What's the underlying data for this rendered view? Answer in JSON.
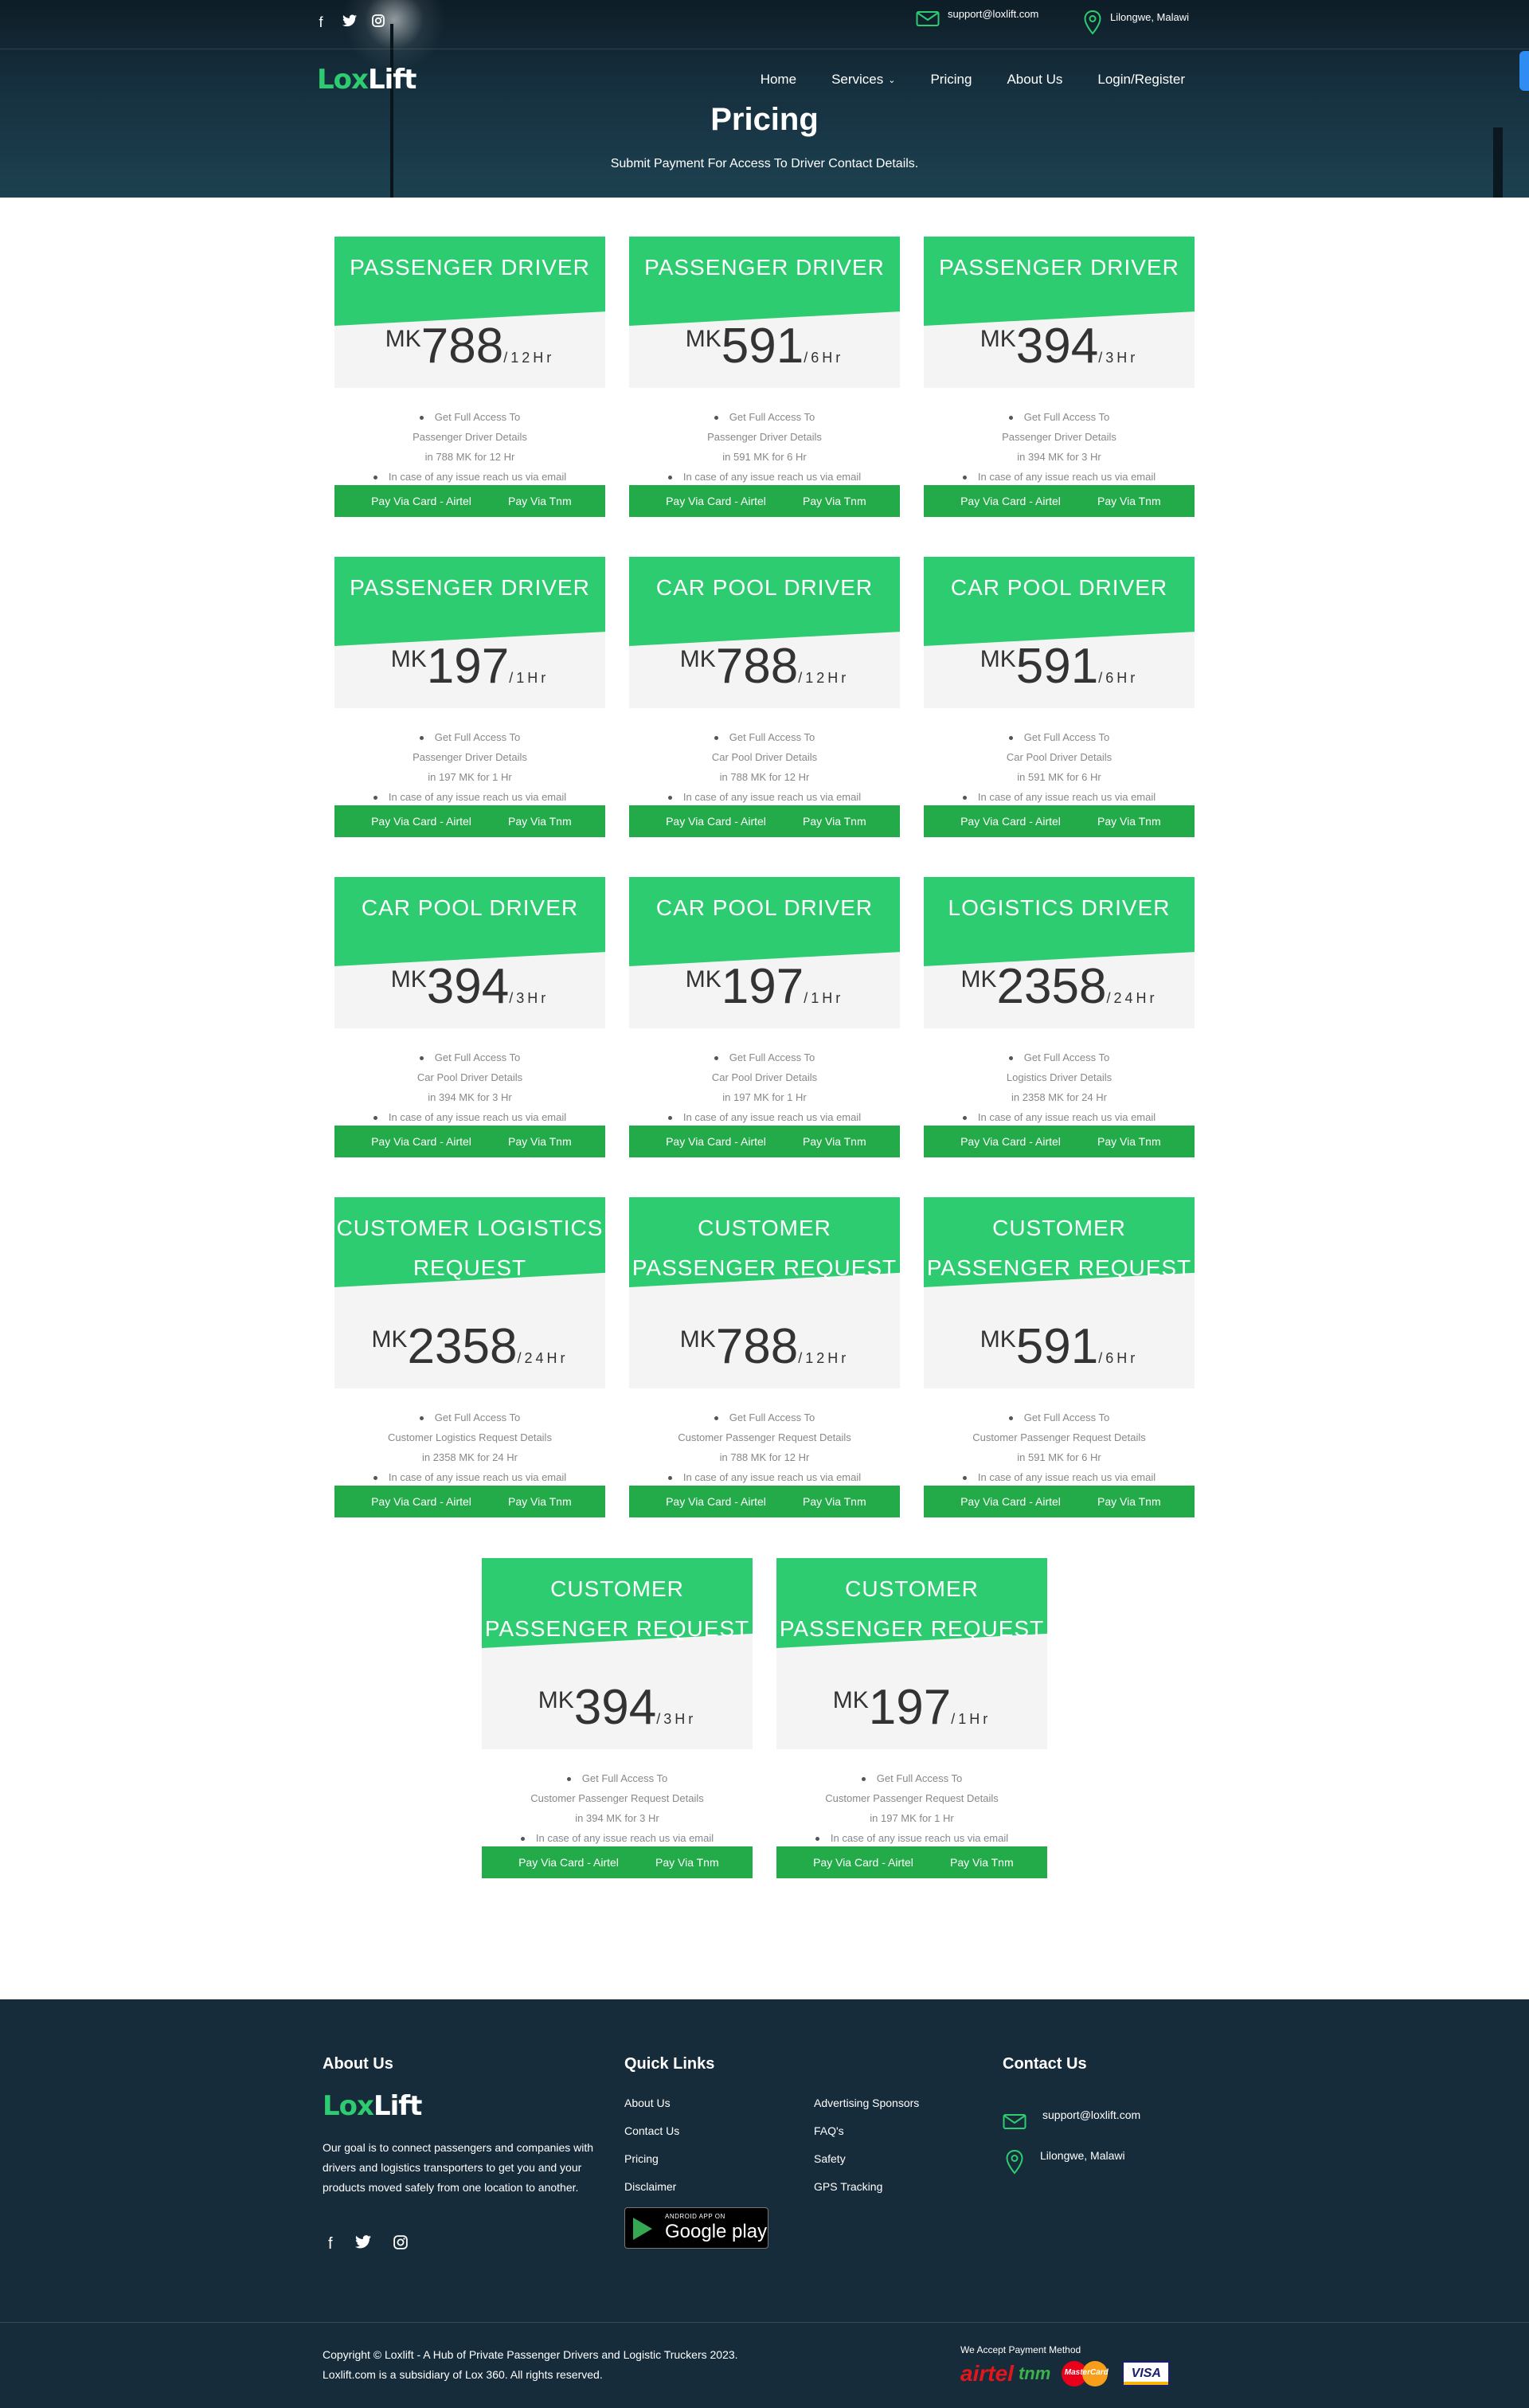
{
  "header": {
    "email": "support@loxlift.com",
    "location": "Lilongwe, Malawi",
    "logo_lox": "Lox",
    "logo_lift": "Lift",
    "nav": [
      {
        "label": "Home"
      },
      {
        "label": "Services",
        "has_dropdown": true
      },
      {
        "label": "Pricing"
      },
      {
        "label": "About Us"
      },
      {
        "label": "Login/Register"
      }
    ],
    "page_title": "Pricing",
    "page_subtitle": "Submit Payment For Access To Driver Contact Details."
  },
  "cards": [
    {
      "title": "PASSENGER DRIVER",
      "currency": "MK",
      "amount": "788",
      "period": "/12Hr",
      "f1": "Get Full Access To",
      "f2": "Passenger Driver Details",
      "f3": "in 788 MK for 12 Hr",
      "f4": "In case of any issue reach us via email",
      "btn1": "Pay Via Card - Airtel",
      "btn2": "Pay Via Tnm"
    },
    {
      "title": "PASSENGER DRIVER",
      "currency": "MK",
      "amount": "591",
      "period": "/6Hr",
      "f1": "Get Full Access To",
      "f2": "Passenger Driver Details",
      "f3": "in 591 MK for 6 Hr",
      "f4": "In case of any issue reach us via email",
      "btn1": "Pay Via Card - Airtel",
      "btn2": "Pay Via Tnm"
    },
    {
      "title": "PASSENGER DRIVER",
      "currency": "MK",
      "amount": "394",
      "period": "/3Hr",
      "f1": "Get Full Access To",
      "f2": "Passenger Driver Details",
      "f3": "in 394 MK for 3 Hr",
      "f4": "In case of any issue reach us via email",
      "btn1": "Pay Via Card - Airtel",
      "btn2": "Pay Via Tnm"
    },
    {
      "title": "PASSENGER DRIVER",
      "currency": "MK",
      "amount": "197",
      "period": "/1Hr",
      "f1": "Get Full Access To",
      "f2": "Passenger Driver Details",
      "f3": "in 197 MK for 1 Hr",
      "f4": "In case of any issue reach us via email",
      "btn1": "Pay Via Card - Airtel",
      "btn2": "Pay Via Tnm"
    },
    {
      "title": "CAR POOL DRIVER",
      "currency": "MK",
      "amount": "788",
      "period": "/12Hr",
      "f1": "Get Full Access To",
      "f2": "Car Pool Driver Details",
      "f3": "in 788 MK for 12 Hr",
      "f4": "In case of any issue reach us via email",
      "btn1": "Pay Via Card - Airtel",
      "btn2": "Pay Via Tnm"
    },
    {
      "title": "CAR POOL DRIVER",
      "currency": "MK",
      "amount": "591",
      "period": "/6Hr",
      "f1": "Get Full Access To",
      "f2": "Car Pool Driver Details",
      "f3": "in 591 MK for 6 Hr",
      "f4": "In case of any issue reach us via email",
      "btn1": "Pay Via Card - Airtel",
      "btn2": "Pay Via Tnm"
    },
    {
      "title": "CAR POOL DRIVER",
      "currency": "MK",
      "amount": "394",
      "period": "/3Hr",
      "f1": "Get Full Access To",
      "f2": "Car Pool Driver Details",
      "f3": "in 394 MK for 3 Hr",
      "f4": "In case of any issue reach us via email",
      "btn1": "Pay Via Card - Airtel",
      "btn2": "Pay Via Tnm"
    },
    {
      "title": "CAR POOL DRIVER",
      "currency": "MK",
      "amount": "197",
      "period": "/1Hr",
      "f1": "Get Full Access To",
      "f2": "Car Pool Driver Details",
      "f3": "in 197 MK for 1 Hr",
      "f4": "In case of any issue reach us via email",
      "btn1": "Pay Via Card - Airtel",
      "btn2": "Pay Via Tnm"
    },
    {
      "title": "LOGISTICS DRIVER",
      "currency": "MK",
      "amount": "2358",
      "period": "/24Hr",
      "f1": "Get Full Access To",
      "f2": "Logistics Driver Details",
      "f3": "in 2358 MK for 24 Hr",
      "f4": "In case of any issue reach us via email",
      "btn1": "Pay Via Card - Airtel",
      "btn2": "Pay Via Tnm"
    },
    {
      "title": "CUSTOMER LOGISTICS REQUEST",
      "currency": "MK",
      "amount": "2358",
      "period": "/24Hr",
      "f1": "Get Full Access To",
      "f2": "Customer Logistics Request Details",
      "f3": "in 2358 MK for 24 Hr",
      "f4": "In case of any issue reach us via email",
      "btn1": "Pay Via Card - Airtel",
      "btn2": "Pay Via Tnm"
    },
    {
      "title": "CUSTOMER PASSENGER REQUEST",
      "currency": "MK",
      "amount": "788",
      "period": "/12Hr",
      "f1": "Get Full Access To",
      "f2": "Customer Passenger Request Details",
      "f3": "in 788 MK for 12 Hr",
      "f4": "In case of any issue reach us via email",
      "btn1": "Pay Via Card - Airtel",
      "btn2": "Pay Via Tnm"
    },
    {
      "title": "CUSTOMER PASSENGER REQUEST",
      "currency": "MK",
      "amount": "591",
      "period": "/6Hr",
      "f1": "Get Full Access To",
      "f2": "Customer Passenger Request Details",
      "f3": "in 591 MK for 6 Hr",
      "f4": "In case of any issue reach us via email",
      "btn1": "Pay Via Card - Airtel",
      "btn2": "Pay Via Tnm"
    },
    {
      "title": "CUSTOMER PASSENGER REQUEST",
      "currency": "MK",
      "amount": "394",
      "period": "/3Hr",
      "f1": "Get Full Access To",
      "f2": "Customer Passenger Request Details",
      "f3": "in 394 MK for 3 Hr",
      "f4": "In case of any issue reach us via email",
      "btn1": "Pay Via Card - Airtel",
      "btn2": "Pay Via Tnm"
    },
    {
      "title": "CUSTOMER PASSENGER REQUEST",
      "currency": "MK",
      "amount": "197",
      "period": "/1Hr",
      "f1": "Get Full Access To",
      "f2": "Customer Passenger Request Details",
      "f3": "in 197 MK for 1 Hr",
      "f4": "In case of any issue reach us via email",
      "btn1": "Pay Via Card - Airtel",
      "btn2": "Pay Via Tnm"
    }
  ],
  "footer": {
    "about_title": "About Us",
    "about_text": "Our goal is to connect passengers and companies with drivers and logistics transporters to get you and your products moved safely from one location to another.",
    "quick_links_title": "Quick Links",
    "links_col1": [
      "About Us",
      "Contact Us",
      "Pricing",
      "Disclaimer"
    ],
    "links_col2": [
      "Advertising Sponsors",
      "FAQ's",
      "Safety",
      "GPS Tracking"
    ],
    "google_play_small": "ANDROID APP ON",
    "google_play_big": "Google play",
    "contact_title": "Contact Us",
    "email": "support@loxlift.com",
    "location": "Lilongwe, Malawi",
    "copyright_line1": "Copyright © Loxlift - A Hub of Private Passenger Drivers and Logistic Truckers 2023.",
    "copyright_line2": "Loxlift.com is a subsidiary of Lox 360. All rights reserved.",
    "accept_label": "We Accept Payment Method",
    "payment_logos": {
      "airtel": "airtel",
      "tnm": "tnm",
      "mastercard": "MasterCard",
      "visa": "VISA"
    }
  },
  "colors": {
    "accent_green": "#2ecc71",
    "button_green": "#22ab48",
    "footer_bg": "#172c3b"
  },
  "icons": [
    "facebook-icon",
    "twitter-icon",
    "instagram-icon",
    "envelope-icon",
    "map-pin-icon",
    "chevron-down-icon",
    "google-play-icon"
  ]
}
